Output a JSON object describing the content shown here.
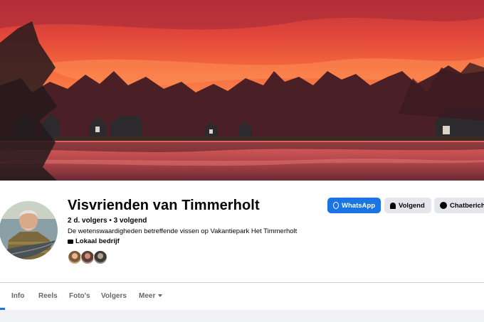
{
  "page": {
    "name": "Visvrienden van Timmerholt",
    "followers": "2 d. volgers • 3 volgend",
    "description": "De wetenswaardigheden betreffende vissen op Vakantiepark Het Timmerholt",
    "category": "Lokaal bedrijf",
    "category_icon": "briefcase-icon"
  },
  "actions": {
    "whatsapp_label": "WhatsApp",
    "follow_label": "Volgend",
    "chat_label": "Chatbericht"
  },
  "tabs": [
    {
      "label": "Info"
    },
    {
      "label": "Reels"
    },
    {
      "label": "Foto's"
    },
    {
      "label": "Volgers"
    },
    {
      "label": "Meer"
    }
  ],
  "colors": {
    "accent": "#1b74e4",
    "button_secondary": "#e4e6eb",
    "background": "#f0f2f5"
  }
}
